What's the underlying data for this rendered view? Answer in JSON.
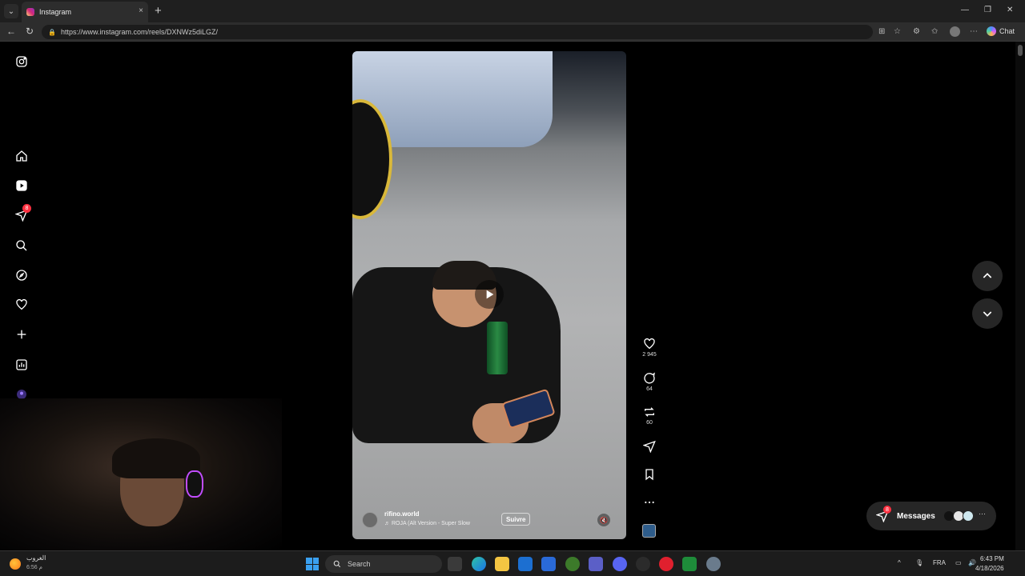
{
  "browser": {
    "tab_title": "Instagram",
    "tab_close": "×",
    "new_tab": "+",
    "url": "https://www.instagram.com/reels/DXNWz5diLGZ/",
    "chat_label": "Chat",
    "minimize": "—",
    "restore": "❐",
    "close": "✕"
  },
  "sidebar": {
    "notification_count": "8"
  },
  "reel": {
    "username": "rifino.world",
    "audio": "♬ ROJA (Alt Version - Super Slow",
    "follow_label": "Suivre",
    "mute_icon": "🔇"
  },
  "actions": {
    "likes": "2 945",
    "comments": "64",
    "reposts": "60"
  },
  "messages": {
    "label": "Messages",
    "badge": "8"
  },
  "taskbar": {
    "weather_title": "الغروب",
    "weather_sub": "م 6:56",
    "search_placeholder": "Search",
    "language": "FRA",
    "time": "6:43 PM",
    "date": "4/18/2026"
  },
  "colors": {
    "accent_badge": "#ff3040",
    "page_bg": "#000000",
    "panel_bg": "#262626"
  }
}
